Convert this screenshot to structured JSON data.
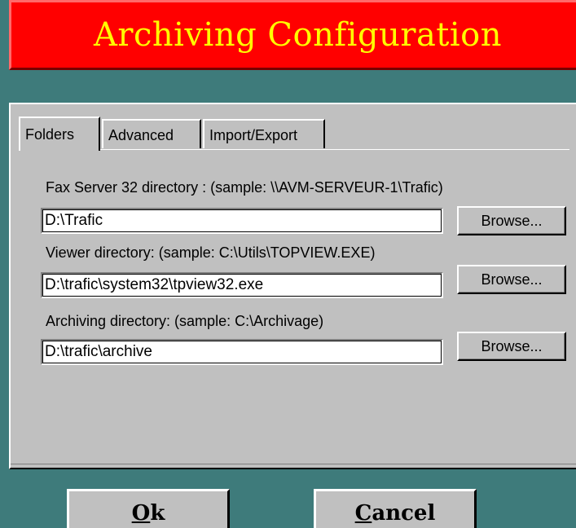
{
  "window": {
    "title": "Archiving Configuration"
  },
  "tabs": [
    {
      "label": "Folders",
      "active": true
    },
    {
      "label": "Advanced",
      "active": false
    },
    {
      "label": "Import/Export",
      "active": false
    }
  ],
  "folders": {
    "fax_server": {
      "label": "Fax Server 32 directory : (sample: \\\\AVM-SERVEUR-1\\Trafic)",
      "value": "D:\\Trafic",
      "browse_label": "Browse..."
    },
    "viewer": {
      "label": "Viewer directory: (sample: C:\\Utils\\TOPVIEW.EXE)",
      "value": "D:\\trafic\\system32\\tpview32.exe",
      "browse_label": "Browse..."
    },
    "archive": {
      "label": "Archiving directory: (sample: C:\\Archivage)",
      "value": "D:\\trafic\\archive",
      "browse_label": "Browse..."
    }
  },
  "buttons": {
    "ok": {
      "first": "O",
      "rest": "k"
    },
    "cancel": {
      "first": "C",
      "rest": "ancel"
    }
  },
  "colors": {
    "background": "#3e7b7b",
    "title_bar": "#ff0000",
    "title_text": "#ffff00",
    "panel": "#c0c0c0"
  }
}
